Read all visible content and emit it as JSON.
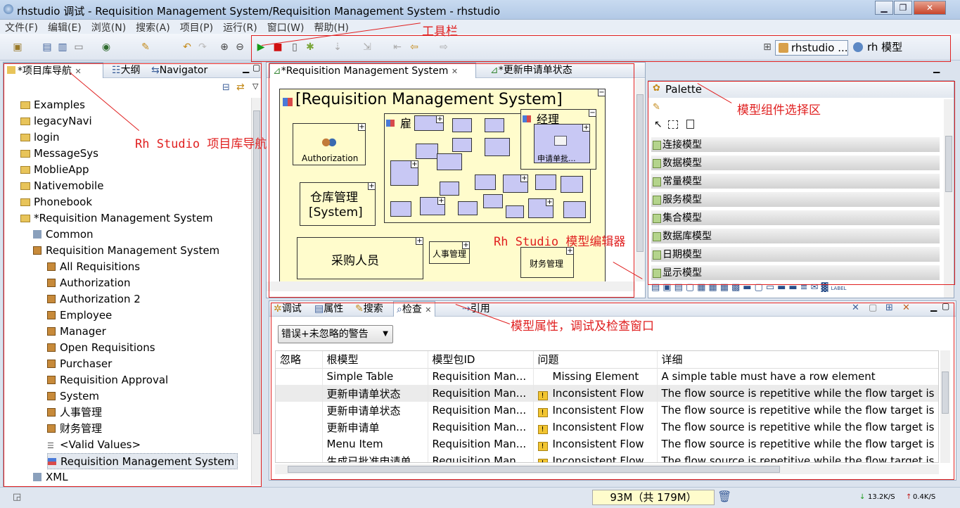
{
  "window": {
    "title": "rhstudio 调试 - Requisition Management System/Requisition Management System - rhstudio",
    "min": "▁",
    "max": "❐",
    "close": "✕"
  },
  "menu": [
    "文件(F)",
    "编辑(E)",
    "浏览(N)",
    "搜索(A)",
    "项目(P)",
    "运行(R)",
    "窗口(W)",
    "帮助(H)"
  ],
  "perspectives": {
    "p1": "rhstudio ...",
    "p2": "rh 模型"
  },
  "left_panel": {
    "tabs": [
      "*项目库导航",
      "大纲",
      "Navigator"
    ],
    "tree": [
      "Examples",
      "legacyNavi",
      "login",
      "MessageSys",
      "MoblieApp",
      "Nativemobile",
      "Phonebook",
      "*Requisition Management System",
      "Common",
      "Requisition Management System",
      "All Requisitions",
      "Authorization",
      "Authorization 2",
      "Employee",
      "Manager",
      "Open Requisitions",
      "Purchaser",
      "Requisition Approval",
      "System",
      "人事管理",
      "财务管理",
      "<Valid Values>",
      "Requisition Management System",
      "XML"
    ]
  },
  "editor": {
    "tabs": [
      "*Requisition Management System",
      "*更新申请单状态"
    ],
    "diagram": {
      "title": "[Requisition Management System]",
      "authorization": "Authorization",
      "employees": "雇",
      "manager": "经理",
      "request": "申请单批...",
      "warehouse1": "仓库管理",
      "warehouse2": "[System]",
      "purchaser": "采购人员",
      "hr": "人事管理",
      "finance": "财务管理"
    }
  },
  "palette": {
    "title": "Palette",
    "groups": [
      "连接模型",
      "数据模型",
      "常量模型",
      "服务模型",
      "集合模型",
      "数据库模型",
      "日期模型",
      "显示模型"
    ]
  },
  "bottom": {
    "tabs": [
      "调试",
      "属性",
      "搜索",
      "检查",
      "引用"
    ],
    "filter": "错误+未忽略的警告",
    "columns": [
      "忽略",
      "根模型",
      "模型包ID",
      "问题",
      "详细"
    ],
    "rows": [
      [
        "",
        "Simple Table",
        "Requisition Man...",
        "Missing Element",
        "A simple table must have a row element"
      ],
      [
        "",
        "更新申请单状态",
        "Requisition Man...",
        "Inconsistent Flow",
        "The flow source is repetitive while the flow target is no"
      ],
      [
        "",
        "更新申请单状态",
        "Requisition Man...",
        "Inconsistent Flow",
        "The flow source is repetitive while the flow target is no"
      ],
      [
        "",
        "更新申请单",
        "Requisition Man...",
        "Inconsistent Flow",
        "The flow source is repetitive while the flow target is no"
      ],
      [
        "",
        "Menu Item",
        "Requisition Man...",
        "Inconsistent Flow",
        "The flow source is repetitive while the flow target is no"
      ],
      [
        "",
        "生成已批准申请单...",
        "Requisition Man...",
        "Inconsistent Flow",
        "The flow source is repetitive while the flow target is no"
      ]
    ]
  },
  "status": {
    "memory": "93M（共 179M）",
    "net_down": "13.2K/S",
    "net_up": "0.4K/S"
  },
  "annotations": {
    "toolbar": "工具栏",
    "navigator": "Rh Studio 项目库导航",
    "palette": "模型组件选择区",
    "editor": "Rh Studio 模型编辑器",
    "bottom": "模型属性，调试及检查窗口"
  },
  "colors": {
    "annotation": "#e02020",
    "diagram_fill": "#fffccc",
    "shape_fill": "#c8c8f4"
  }
}
